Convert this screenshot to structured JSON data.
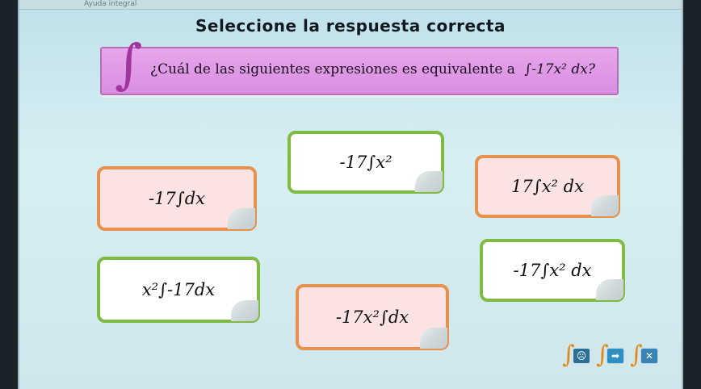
{
  "topbar": {
    "title": "Ayuda integral"
  },
  "heading": "Seleccione la respuesta correcta",
  "question": {
    "text": "¿Cuál de las siguientes expresiones es equivalente a",
    "expression": "∫-17x² dx?"
  },
  "options": [
    {
      "id": "a",
      "text": "-17∫x²"
    },
    {
      "id": "b",
      "text": "-17∫dx"
    },
    {
      "id": "c",
      "text": "17∫x² dx"
    },
    {
      "id": "d",
      "text": "-17∫x² dx"
    },
    {
      "id": "e",
      "text": "x²∫-17dx"
    },
    {
      "id": "f",
      "text": "-17x²∫dx"
    }
  ],
  "controls": {
    "help_icon": "integral-help-icon",
    "next_icon": "integral-next-icon",
    "close_icon": "integral-close-icon",
    "help_symbol": "☹",
    "next_symbol": "➡",
    "close_symbol": "✕"
  },
  "colors": {
    "green_border": "#7dbb42",
    "orange_border": "#e8914c",
    "question_bg": "#d98ee0"
  }
}
